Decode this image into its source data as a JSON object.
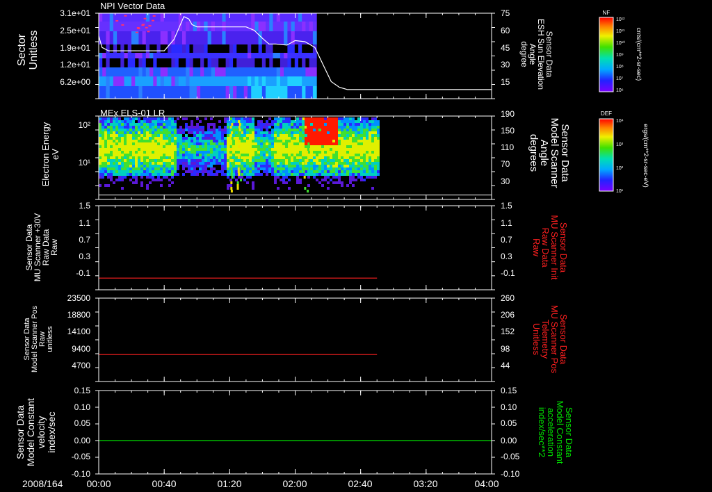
{
  "colors": {
    "axis": "#ffffff",
    "red_trace": "#ff2020",
    "green_trace": "#00e000",
    "label_white": "#ffffff",
    "label_red": "#ff2020",
    "label_green": "#00e000"
  },
  "date_label": "2008/164",
  "time_ticks": [
    "00:00",
    "00:40",
    "01:20",
    "02:00",
    "02:40",
    "03:20",
    "04:00"
  ],
  "colorbars": [
    {
      "title": "NF",
      "unit": "cnts/(cm**2-sr-sec)",
      "ticks": [
        "10¹²",
        "10¹¹",
        "10¹⁰",
        "10⁹",
        "10⁸",
        "10⁷",
        "10⁶"
      ]
    },
    {
      "title": "DEF",
      "unit": "ergs/(cm**2-sr-sec-eV)",
      "ticks": [
        "10⁴",
        "10³",
        "10²",
        "10¹"
      ]
    }
  ],
  "panels": [
    {
      "title": "NPI Vector Data",
      "left_label": [
        "Sector",
        "Unitless"
      ],
      "left_ticks": [
        "3.1e+01",
        "2.5e+01",
        "1.9e+01",
        "1.2e+01",
        "6.2e+00"
      ],
      "right_label": [
        "Sensor Data",
        "ESH Sun Elevation",
        "Angle",
        "degree"
      ],
      "right_ticks": [
        "75",
        "60",
        "45",
        "30",
        "15"
      ]
    },
    {
      "title": "MEx ELS-01 LR",
      "left_label": [
        "Electron Energy",
        "eV"
      ],
      "left_ticks": [
        "10²",
        "10¹"
      ],
      "right_label": [
        "Sensor Data",
        "Model Scanner",
        "Angle",
        "degrees"
      ],
      "right_ticks": [
        "190",
        "150",
        "110",
        "70",
        "30"
      ]
    },
    {
      "title": "",
      "left_label": [
        "Sensor Data",
        "MU Scanner +30V",
        "Raw Data",
        "Raw"
      ],
      "left_ticks": [
        "1.5",
        "1.1",
        "0.7",
        "0.3",
        "-0.1"
      ],
      "right_label": [
        "Sensor Data",
        "MU Scanner Init",
        "Raw Data",
        "Raw"
      ],
      "right_ticks": [
        "1.5",
        "1.1",
        "0.7",
        "0.3",
        "-0.1"
      ]
    },
    {
      "title": "",
      "left_label": [
        "Sensor Data",
        "Model Scanner Pos",
        "Raw",
        "unitless"
      ],
      "left_ticks": [
        "23500",
        "18800",
        "14100",
        "9400",
        "4700"
      ],
      "right_label": [
        "Sensor Data",
        "MU Scanner Pos",
        "Telemetry",
        "Unitless"
      ],
      "right_ticks": [
        "260",
        "206",
        "152",
        "98",
        "44"
      ]
    },
    {
      "title": "",
      "left_label": [
        "Sensor Data",
        "Model Constant",
        "velocity",
        "index/sec"
      ],
      "left_ticks": [
        "0.15",
        "0.10",
        "0.05",
        "0.00",
        "-0.05",
        "-0.10"
      ],
      "right_label": [
        "Sensor Data",
        "Model Constant",
        "acceleration",
        "index/sec**2"
      ],
      "right_ticks": [
        "0.15",
        "0.10",
        "0.05",
        "0.00",
        "-0.05",
        "-0.10"
      ]
    }
  ],
  "chart_data": [
    {
      "type": "heatmap",
      "title": "NPI Vector Data",
      "xlabel": "",
      "ylabel": "Sector Unitless",
      "ylim": [
        0,
        31
      ],
      "x_range": [
        "00:00",
        "04:00"
      ],
      "data_extent": [
        "00:00",
        "02:13"
      ],
      "overlay_line": {
        "ylabel": "Sensor Data ESH Sun Elevation Angle degree",
        "ylim": [
          0,
          75
        ],
        "x": [
          "00:00",
          "00:02",
          "00:06",
          "00:40",
          "00:46",
          "00:52",
          "00:55",
          "00:57",
          "01:00",
          "01:05",
          "01:30",
          "01:35",
          "01:40",
          "01:44",
          "01:48",
          "01:55",
          "02:00",
          "02:06",
          "02:12",
          "02:17",
          "02:22",
          "02:27",
          "02:32",
          "04:00"
        ],
        "y": [
          55,
          45,
          42,
          42,
          52,
          72,
          70,
          65,
          63,
          63,
          63,
          60,
          53,
          48,
          48,
          47,
          51,
          50,
          45,
          30,
          15,
          10,
          8,
          8
        ]
      }
    },
    {
      "type": "heatmap",
      "title": "MEx ELS-01 LR",
      "xlabel": "",
      "ylabel": "Electron Energy eV",
      "yscale": "log",
      "ylim": [
        1,
        200
      ],
      "x_range": [
        "00:00",
        "04:00"
      ],
      "data_extent": [
        "00:00",
        "02:50"
      ],
      "overlay_line": {
        "ylabel": "Sensor Data Model Scanner Angle degrees",
        "ylim": [
          0,
          190
        ],
        "x": [
          "00:00",
          "02:50"
        ],
        "y": [
          10,
          10
        ]
      }
    },
    {
      "type": "line",
      "title": "",
      "ylabel": "Sensor Data MU Scanner +30V Raw Data Raw",
      "ylim": [
        -0.3,
        1.5
      ],
      "series": [
        {
          "x": [
            "00:00",
            "02:50"
          ],
          "y": [
            -0.05,
            -0.05
          ]
        }
      ]
    },
    {
      "type": "line",
      "title": "",
      "ylabel": "Sensor Data Model Scanner Pos Raw unitless",
      "ylim": [
        0,
        23500
      ],
      "series": [
        {
          "x": [
            "00:00",
            "02:50"
          ],
          "y": [
            7600,
            7600
          ]
        }
      ]
    },
    {
      "type": "line",
      "title": "",
      "ylabel": "Sensor Data Model Constant velocity index/sec",
      "ylim": [
        -0.1,
        0.15
      ],
      "series": [
        {
          "x": [
            "00:00",
            "04:00"
          ],
          "y": [
            0.0,
            0.0
          ]
        }
      ]
    }
  ]
}
